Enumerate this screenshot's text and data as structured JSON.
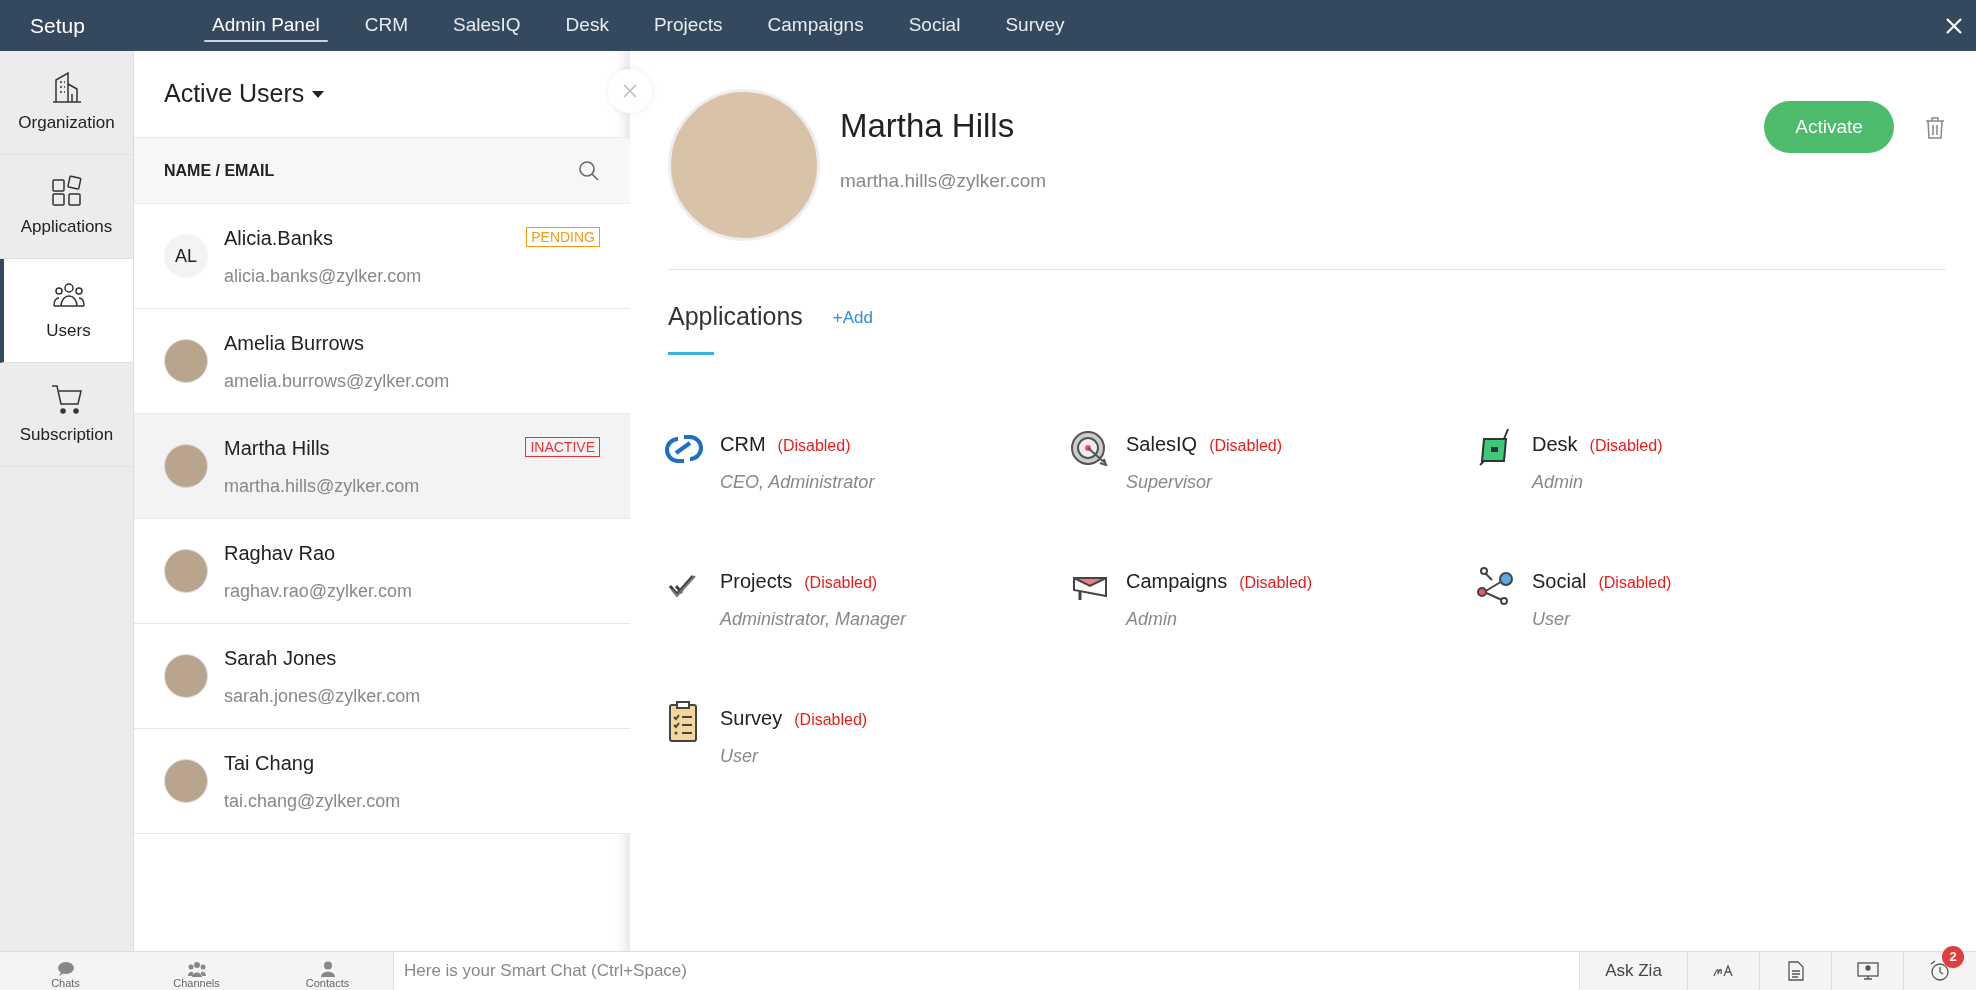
{
  "topbar": {
    "title": "Setup",
    "tabs": [
      {
        "label": "Admin Panel",
        "selected": true
      },
      {
        "label": "CRM",
        "selected": false
      },
      {
        "label": "SalesIQ",
        "selected": false
      },
      {
        "label": "Desk",
        "selected": false
      },
      {
        "label": "Projects",
        "selected": false
      },
      {
        "label": "Campaigns",
        "selected": false
      },
      {
        "label": "Social",
        "selected": false
      },
      {
        "label": "Survey",
        "selected": false
      }
    ]
  },
  "sidebar": {
    "items": [
      {
        "kind": "organization",
        "label": "Organization",
        "selected": false
      },
      {
        "kind": "applications",
        "label": "Applications",
        "selected": false
      },
      {
        "kind": "users",
        "label": "Users",
        "selected": true
      },
      {
        "kind": "subscription",
        "label": "Subscription",
        "selected": false
      }
    ]
  },
  "user_list": {
    "title": "Active Users",
    "column_header": "NAME / EMAIL",
    "rows": [
      {
        "initials": "AL",
        "name": "Alicia.Banks",
        "email": "alicia.banks@zylker.com",
        "status": "PENDING",
        "color": "#f39c12",
        "selected": false
      },
      {
        "name": "Amelia Burrows",
        "email": "amelia.burrows@zylker.com",
        "selected": false
      },
      {
        "name": "Martha Hills",
        "email": "martha.hills@zylker.com",
        "status": "INACTIVE",
        "color": "#e8333c",
        "selected": true
      },
      {
        "name": "Raghav Rao",
        "email": "raghav.rao@zylker.com",
        "selected": false
      },
      {
        "name": "Sarah Jones",
        "email": "sarah.jones@zylker.com",
        "selected": false
      },
      {
        "name": "Tai Chang",
        "email": "tai.chang@zylker.com",
        "selected": false
      }
    ]
  },
  "detail": {
    "name": "Martha Hills",
    "email": "martha.hills@zylker.com",
    "action": "Activate",
    "section_title": "Applications",
    "add_link": "+Add",
    "apps": [
      {
        "kind": "crm",
        "name": "CRM",
        "state": "(Disabled)",
        "roles": "CEO, Administrator"
      },
      {
        "kind": "salesiq",
        "name": "SalesIQ",
        "state": "(Disabled)",
        "roles": "Supervisor"
      },
      {
        "kind": "desk",
        "name": "Desk",
        "state": "(Disabled)",
        "roles": "Admin"
      },
      {
        "kind": "projects",
        "name": "Projects",
        "state": "(Disabled)",
        "roles": "Administrator, Manager"
      },
      {
        "kind": "campaigns",
        "name": "Campaigns",
        "state": "(Disabled)",
        "roles": "Admin"
      },
      {
        "kind": "social",
        "name": "Social",
        "state": "(Disabled)",
        "roles": "User"
      },
      {
        "kind": "survey",
        "name": "Survey",
        "state": "(Disabled)",
        "roles": "User"
      }
    ]
  },
  "bottom_bar": {
    "nav": [
      {
        "kind": "chats",
        "label": "Chats"
      },
      {
        "kind": "channels",
        "label": "Channels"
      },
      {
        "kind": "contacts",
        "label": "Contacts"
      }
    ],
    "chat_placeholder": "Here is your Smart Chat (Ctrl+Space)",
    "ask_zia": "Ask Zia",
    "reminder_count": "2"
  }
}
